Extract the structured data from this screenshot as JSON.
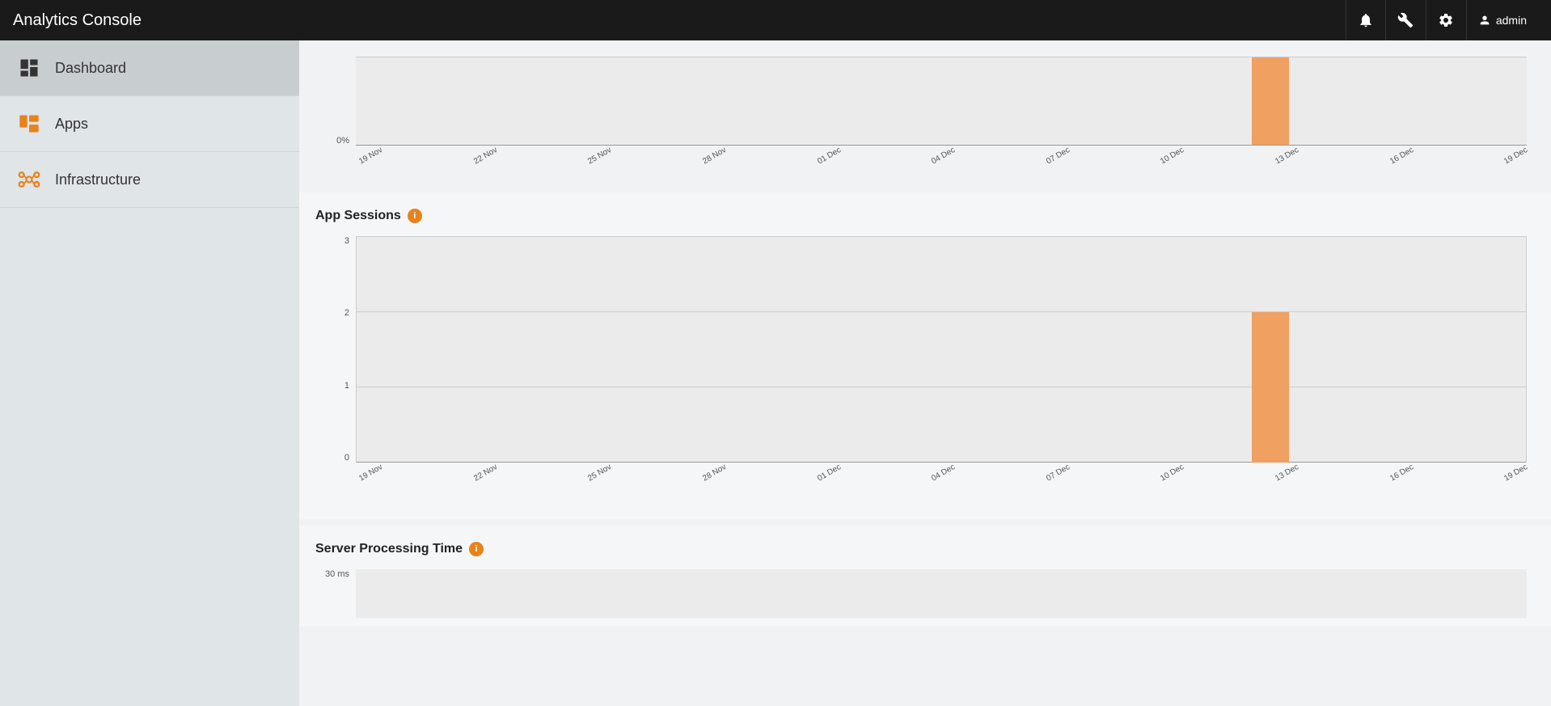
{
  "header": {
    "title": "Analytics Console",
    "notification_icon": "🔔",
    "wrench_icon": "🔧",
    "gear_icon": "⚙",
    "admin_label": "admin"
  },
  "sidebar": {
    "items": [
      {
        "label": "Dashboard",
        "icon": "dashboard",
        "active": true
      },
      {
        "label": "Apps",
        "icon": "apps",
        "active": false
      },
      {
        "label": "Infrastructure",
        "icon": "infrastructure",
        "active": false
      }
    ]
  },
  "charts": {
    "app_sessions": {
      "title": "App Sessions",
      "info_label": "i",
      "y_labels": [
        "3",
        "2",
        "1",
        "0"
      ],
      "x_labels": [
        "19 Nov",
        "22 Nov",
        "25 Nov",
        "28 Nov",
        "01 Dec",
        "04 Dec",
        "07 Dec",
        "10 Dec",
        "13 Dec",
        "16 Dec",
        "19 Dec"
      ],
      "bar": {
        "x_percent": 76.5,
        "value": 2,
        "max": 3,
        "width_percent": 3.2
      }
    },
    "top_chart": {
      "y_labels": [
        "0%"
      ],
      "x_labels": [
        "19 Nov",
        "22 Nov",
        "25 Nov",
        "28 Nov",
        "01 Dec",
        "04 Dec",
        "07 Dec",
        "10 Dec",
        "13 Dec",
        "16 Dec",
        "19 Dec"
      ],
      "bar": {
        "x_percent": 76.5,
        "width_percent": 3.2
      }
    },
    "server_processing_time": {
      "title": "Server Processing Time",
      "info_label": "i",
      "y_label": "30 ms"
    }
  }
}
